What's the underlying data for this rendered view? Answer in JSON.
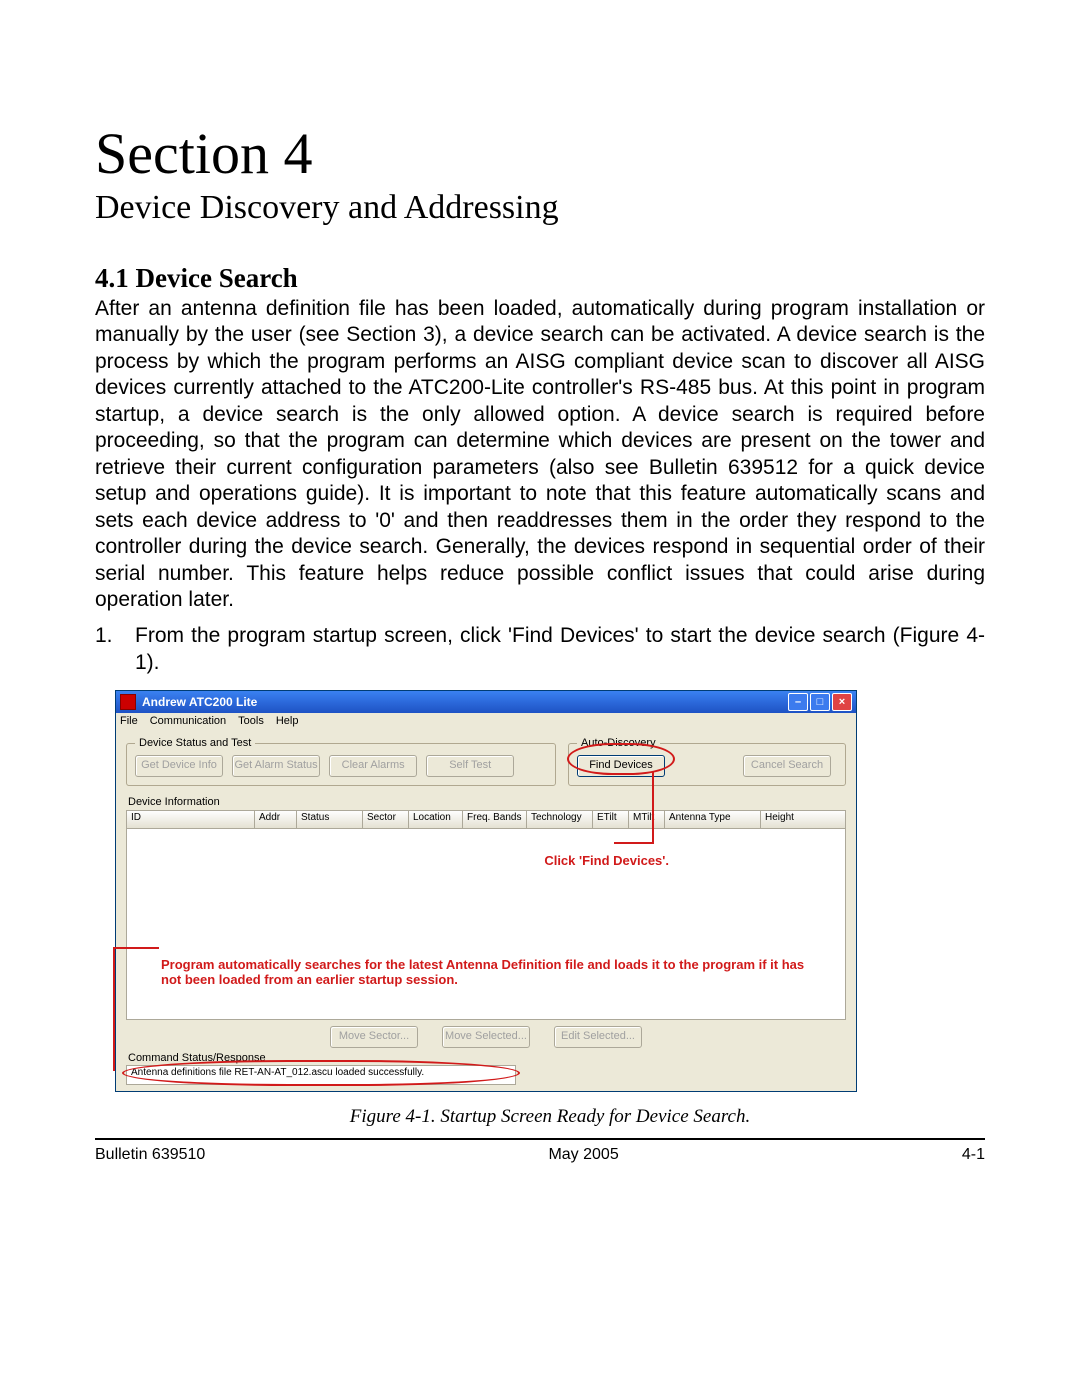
{
  "doc": {
    "section_title": "Section 4",
    "section_sub": "Device Discovery and Addressing",
    "h41": "4.1 Device Search",
    "para1": "After an antenna definition file has been loaded, automatically during program installation or manually by the user (see Section 3), a device search can be activated. A device search is the process by which the program performs an AISG compliant device scan to discover all AISG devices currently attached to the ATC200-Lite controller's RS-485 bus. At this point in program startup, a device search is the only allowed option. A device search is required before proceeding, so that the program can determine which devices are present on the tower and retrieve their current configuration parameters (also see Bulletin 639512 for a quick  device setup and operations guide). It is important to note that this feature automatically scans and sets each device address to '0' and then readdresses them in the order they respond to the controller during the device search. Generally, the devices respond in sequential order of their serial number. This feature helps reduce possible conflict issues that could arise during operation later.",
    "list1_num": "1.",
    "list1": "From the program startup screen, click 'Find Devices' to start the device search (Figure 4-1).",
    "caption": "Figure 4-1. Startup Screen Ready for Device Search.",
    "footer_left": "Bulletin 639510",
    "footer_mid": "May 2005",
    "footer_right": "4-1"
  },
  "app": {
    "title": "Andrew ATC200 Lite",
    "menu": {
      "file": "File",
      "comm": "Communication",
      "tools": "Tools",
      "help": "Help"
    },
    "group_status": "Device Status and Test",
    "btn_get_info": "Get Device Info",
    "btn_alarm_status": "Get Alarm Status",
    "btn_clear_alarms": "Clear Alarms",
    "btn_self_test": "Self Test",
    "group_auto": "Auto-Discovery",
    "btn_find": "Find Devices",
    "btn_cancel": "Cancel Search",
    "dev_info_label": "Device Information",
    "cols": {
      "id": "ID",
      "addr": "Addr",
      "status": "Status",
      "sector": "Sector",
      "location": "Location",
      "freq": "Freq. Bands",
      "tech": "Technology",
      "etilt": "ETilt",
      "mtilt": "MTilt",
      "ant": "Antenna Type",
      "height": "Height"
    },
    "btn_move_sector": "Move Sector...",
    "btn_move_selected": "Move Selected...",
    "btn_edit_selected": "Edit Selected...",
    "status_label": "Command Status/Response",
    "status_text": "Antenna definitions file RET-AN-AT_012.ascu loaded successfully."
  },
  "anno": {
    "click_find": "Click 'Find Devices'.",
    "auto_load": "Program automatically searches for the latest Antenna Definition file and loads it to the program if it has not been loaded from an earlier startup session."
  }
}
